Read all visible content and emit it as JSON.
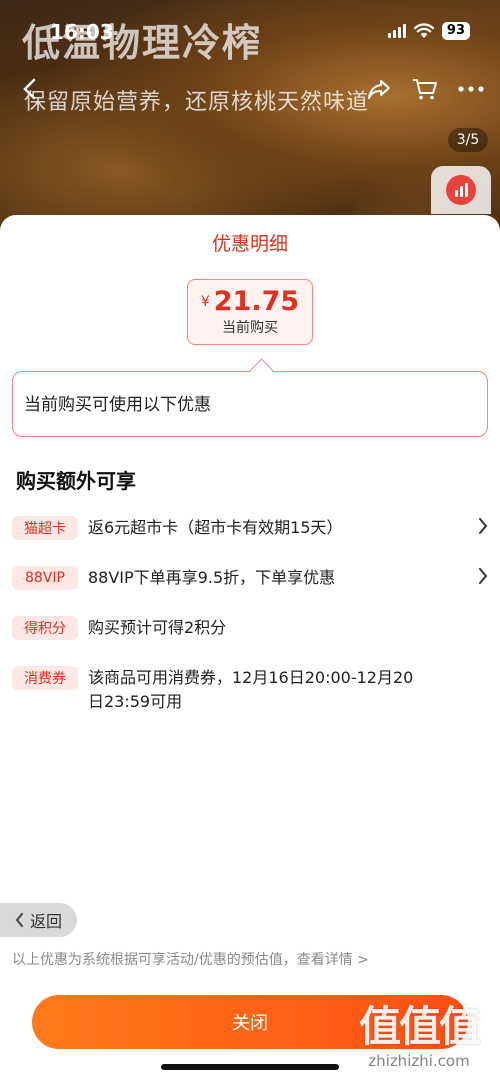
{
  "hero": {
    "title": "低温物理冷榨",
    "subtitle": "保留原始营养，还原核桃天然味道",
    "page_indicator": "3/5"
  },
  "status_bar": {
    "time": "16:03",
    "battery": "93"
  },
  "sheet": {
    "title": "优惠明细",
    "price": {
      "currency": "¥",
      "value": "21.75",
      "caption": "当前购买"
    },
    "bubble_text": "当前购买可使用以下优惠",
    "section_title": "购买额外可享",
    "benefits": [
      {
        "tag": "猫超卡",
        "text": "返6元超市卡（超市卡有效期15天）",
        "has_arrow": true
      },
      {
        "tag": "88VIP",
        "text": "88VIP下单再享9.5折，下单享优惠",
        "has_arrow": true
      },
      {
        "tag": "得积分",
        "text": "购买预计可得2积分",
        "has_arrow": false
      },
      {
        "tag": "消费券",
        "text": "该商品可用消费券，12月16日20:00-12月20日23:59可用",
        "has_arrow": false
      }
    ],
    "back_label": "返回",
    "footnote": "以上优惠为系统根据可享活动/优惠的预估值，查看详情 >",
    "close_label": "关闭"
  },
  "watermark": {
    "big": "值值值",
    "small": "zhizhizhi.com"
  },
  "colors": {
    "accent": "#e0301e",
    "tag_bg": "#fde8e6",
    "button_start": "#ff7a1a",
    "button_end": "#ff4d14"
  },
  "icons": [
    "back-icon",
    "share-icon",
    "cart-icon",
    "more-icon",
    "chart-icon",
    "chevron-right-icon",
    "chevron-left-icon",
    "wifi-icon",
    "signal-icon"
  ]
}
